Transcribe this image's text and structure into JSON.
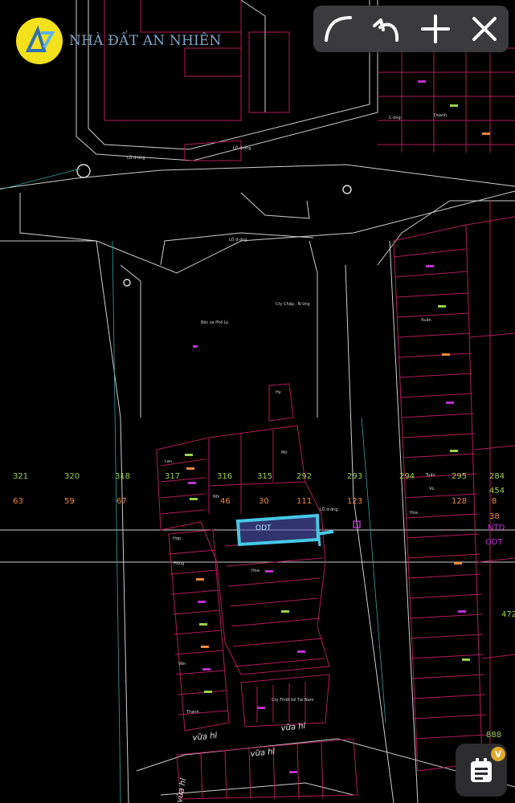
{
  "brand": {
    "name": "NHÀ ĐẤT AN NHIÊN",
    "logo_icon": "an-logo-icon"
  },
  "toolbar": {
    "buttons": [
      {
        "name": "curve-draw-button",
        "icon": "curve-icon"
      },
      {
        "name": "undo-button",
        "icon": "undo-icon"
      },
      {
        "name": "add-button",
        "icon": "plus-icon"
      },
      {
        "name": "close-button",
        "icon": "close-icon"
      }
    ]
  },
  "fab": {
    "icon": "clipboard-icon",
    "badge": "V"
  },
  "colors": {
    "parcel_line": "#b01e5a",
    "road_line": "#cfcfcf",
    "highlight": "#46c8e6",
    "number_green": "#9bd24a",
    "number_orange": "#f08a3a"
  },
  "map": {
    "top_row_numbers": [
      "321",
      "320",
      "318",
      "317",
      "316",
      "315",
      "292",
      "293",
      "294",
      "295",
      "284"
    ],
    "bottom_row_numbers": [
      "63",
      "59",
      "67",
      "46",
      "30",
      "111",
      "123",
      "128",
      "38"
    ],
    "right_edge_numbers": [
      "454",
      "8"
    ],
    "land_type_codes": [
      "ODT",
      "NTD",
      "ODT"
    ],
    "side_numbers": [
      "472",
      "888"
    ],
    "road_names": [
      "vữa hl",
      "vữa hl",
      "vữa hl",
      "vữa hl"
    ],
    "small_labels": [
      "LÔ đ-ờng",
      "LÔ đ-ờng",
      "LÔ đ-ờng",
      "LÔ đ-ờng",
      "Bắc sa Phố Lý",
      "Cty Chấp.. N-ừng",
      "Hy",
      "Mô",
      "Nhi",
      "Cty Thiết kế Tại Nam",
      "Vũ",
      "C-ờng",
      "Hợp",
      "Hoa",
      "Lan",
      "Hùng",
      "Tuấn",
      "Doanh",
      "Thanh",
      "Xuân",
      "Hòa",
      "Vân"
    ]
  }
}
